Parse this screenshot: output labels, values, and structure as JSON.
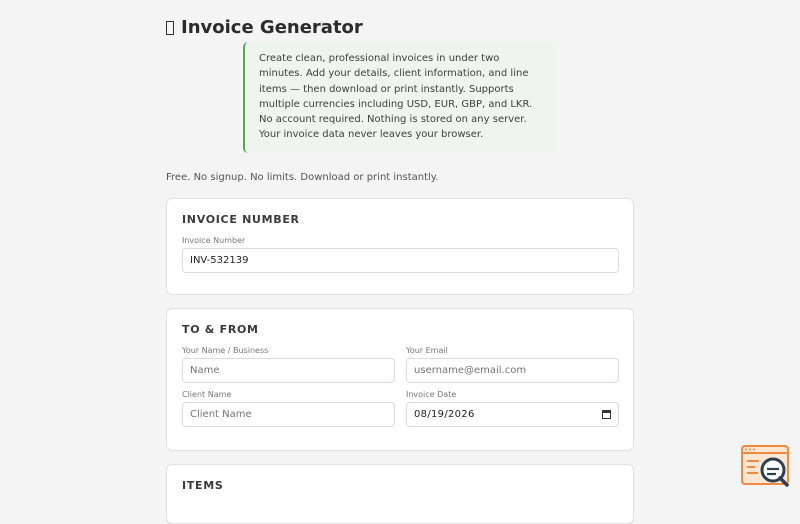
{
  "app": {
    "title": "Invoice Generator",
    "title_icon": "invoice-glyph",
    "intro": "Create clean, professional invoices in under two minutes. Add your details, client information, and line items — then download or print instantly. Supports multiple currencies including USD, EUR, GBP, and LKR. No account required. Nothing is stored on any server. Your invoice data never leaves your browser.",
    "tagline": "Free. No signup. No limits. Download or print instantly."
  },
  "invoice_number_section": {
    "heading": "INVOICE NUMBER",
    "field_label": "Invoice Number",
    "field_value": "INV-532139"
  },
  "to_from_section": {
    "heading": "TO & FROM",
    "your_name": {
      "label": "Your Name / Business",
      "placeholder": "Name"
    },
    "your_email": {
      "label": "Your Email",
      "placeholder": "username@email.com"
    },
    "client_name": {
      "label": "Client Name",
      "placeholder": "Client Name"
    },
    "invoice_date": {
      "label": "Invoice Date",
      "value": "08/19/2026"
    }
  },
  "items_section": {
    "heading": "ITEMS"
  },
  "colors": {
    "accent_green": "#56a85a",
    "intro_bg": "#eef4ee",
    "badge_orange": "#f08a3e",
    "page_bg": "#f4f4f4"
  },
  "icons": {
    "calendar": "calendar-icon",
    "badge": "search-inspect-icon"
  }
}
